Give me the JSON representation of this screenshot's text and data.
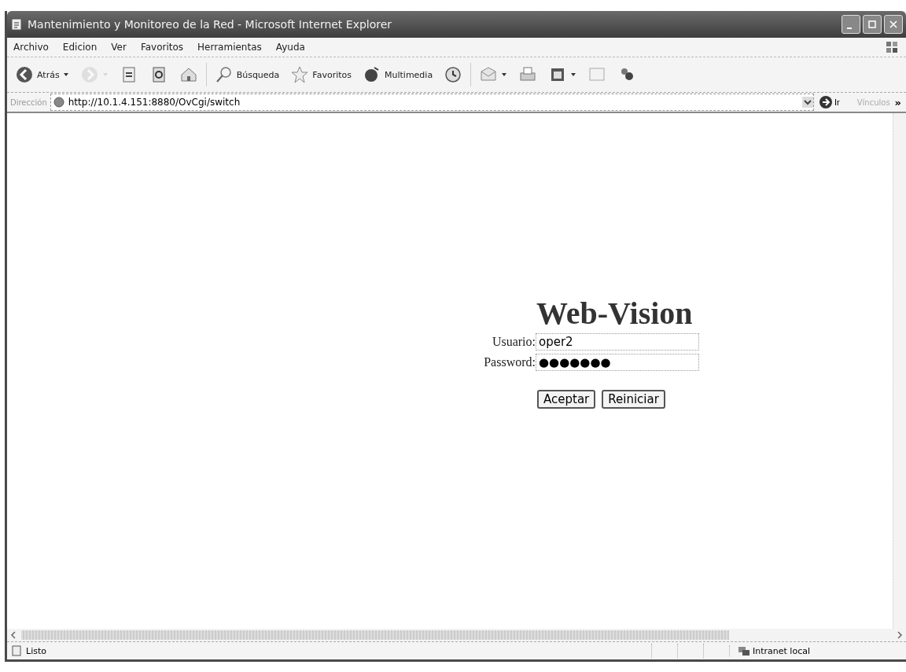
{
  "window": {
    "title": "Mantenimiento y Monitoreo de la Red - Microsoft Internet Explorer"
  },
  "menu": [
    "Archivo",
    "Edicion",
    "Ver",
    "Favoritos",
    "Herramientas",
    "Ayuda"
  ],
  "toolbar": [
    {
      "kind": "back",
      "label": "Atrás",
      "dropdown": true,
      "disabled": false
    },
    {
      "kind": "forward",
      "dropdown": true,
      "disabled": true
    },
    {
      "kind": "stop",
      "disabled": false
    },
    {
      "kind": "refresh",
      "disabled": false
    },
    {
      "kind": "home",
      "disabled": false
    },
    {
      "kind": "search",
      "label": "Búsqueda",
      "disabled": false
    },
    {
      "kind": "favorites",
      "label": "Favoritos",
      "disabled": false
    },
    {
      "kind": "media",
      "label": "Multimedia",
      "disabled": false
    },
    {
      "kind": "history",
      "disabled": false
    },
    {
      "kind": "mail",
      "dropdown": true,
      "disabled": false
    },
    {
      "kind": "print",
      "disabled": false
    },
    {
      "kind": "edit",
      "dropdown": true,
      "disabled": false
    },
    {
      "kind": "discuss",
      "disabled": false
    },
    {
      "kind": "messenger",
      "disabled": false
    }
  ],
  "address_bar": {
    "label": "Dirección",
    "url": "http://10.1.4.151:8880/OvCgi/switch",
    "go": "Ir",
    "links": "Vínculos",
    "more": "»"
  },
  "login": {
    "heading": "Web-Vision",
    "fields": [
      {
        "label": "Usuario:",
        "value": "oper2"
      },
      {
        "label": "Password:",
        "value": "●●●●●●●"
      }
    ],
    "buttons": [
      "Aceptar",
      "Reiniciar"
    ]
  },
  "status_bar": {
    "text": "Listo",
    "zone": "Intranet local"
  }
}
